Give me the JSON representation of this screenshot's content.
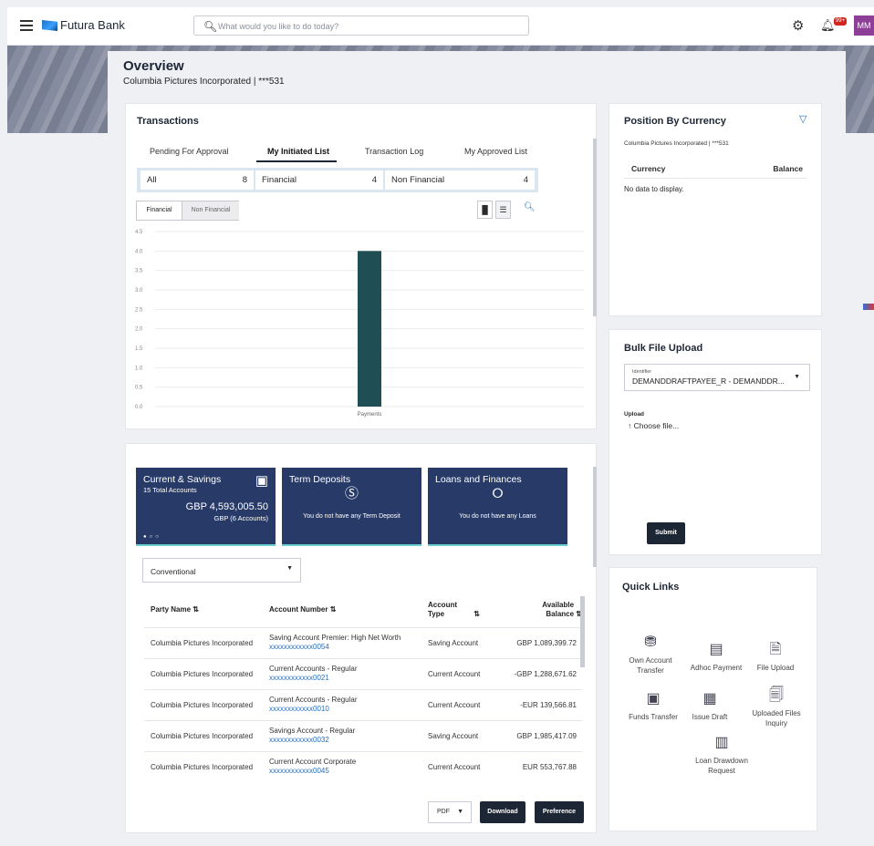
{
  "header": {
    "brand": "Futura Bank",
    "search_placeholder": "What would you like to do today?",
    "notification_badge": "99+",
    "avatar_initials": "MM"
  },
  "page": {
    "title": "Overview",
    "subtitle": "Columbia Pictures Incorporated | ***531"
  },
  "transactions": {
    "title": "Transactions",
    "tabs": [
      "Pending For Approval",
      "My Initiated List",
      "Transaction Log",
      "My Approved List"
    ],
    "active_tab": "My Initiated List",
    "filters": [
      {
        "label": "All",
        "count": "8"
      },
      {
        "label": "Financial",
        "count": "4"
      },
      {
        "label": "Non Financial",
        "count": "4"
      }
    ],
    "toggle": {
      "left": "Financial",
      "right": "Non Financial"
    }
  },
  "chart_data": {
    "type": "bar",
    "categories": [
      "Payments"
    ],
    "values": [
      4
    ],
    "ylim": [
      0,
      4.5
    ],
    "yticks": [
      "0.0",
      "0.5",
      "1.0",
      "1.5",
      "2.0",
      "2.5",
      "3.0",
      "3.5",
      "4.0",
      "4.5"
    ],
    "bar_color": "#1f4e55"
  },
  "position": {
    "title": "Position By Currency",
    "subtitle": "Columbia Pictures Incorporated | ***531",
    "col_currency": "Currency",
    "col_balance": "Balance",
    "empty": "No data to display."
  },
  "bulk": {
    "title": "Bulk File Upload",
    "identifier_label": "Identifier",
    "identifier_value": "DEMANDDRAFTPAYEE_R - DEMANDDR...",
    "upload_label": "Upload",
    "choose_file": "Choose file...",
    "submit": "Submit"
  },
  "quick_links": {
    "title": "Quick Links",
    "items": [
      "Own Account Transfer",
      "Adhoc Payment",
      "File Upload",
      "Funds Transfer",
      "Issue Draft",
      "Uploaded Files Inquiry",
      "Loan Drawdown Request"
    ]
  },
  "tiles": {
    "casa_title": "Current & Savings",
    "casa_sub": "15 Total Accounts",
    "casa_amount": "GBP 4,593,005.50",
    "casa_amount_sub": "GBP (6 Accounts)",
    "td_title": "Term Deposits",
    "td_msg": "You do not have any Term Deposit",
    "loan_title": "Loans and Finances",
    "loan_msg": "You do not have any Loans"
  },
  "accounts": {
    "dropdown": "Conventional",
    "columns": [
      "Party Name",
      "Account Number",
      "Account Type",
      "Available Balance"
    ],
    "rows": [
      {
        "party": "Columbia Pictures Incorporated",
        "desc": "Saving Account Premier: High Net Worth",
        "number": "xxxxxxxxxxxx0054",
        "type": "Saving Account",
        "balance": "GBP 1,089,399.72"
      },
      {
        "party": "Columbia Pictures Incorporated",
        "desc": "Current Accounts - Regular",
        "number": "xxxxxxxxxxxx0021",
        "type": "Current Account",
        "balance": "-GBP 1,288,671.62"
      },
      {
        "party": "Columbia Pictures Incorporated",
        "desc": "Current Accounts - Regular",
        "number": "xxxxxxxxxxxx0010",
        "type": "Current Account",
        "balance": "-EUR 139,566.81"
      },
      {
        "party": "Columbia Pictures Incorporated",
        "desc": "Savings Account - Regular",
        "number": "xxxxxxxxxxxx0032",
        "type": "Saving Account",
        "balance": "GBP 1,985,417.09"
      },
      {
        "party": "Columbia Pictures Incorporated",
        "desc": "Current Account Corporate",
        "number": "xxxxxxxxxxxx0045",
        "type": "Current Account",
        "balance": "EUR 553,767.88"
      }
    ],
    "format": "PDF",
    "download": "Download",
    "preference": "Preference"
  }
}
